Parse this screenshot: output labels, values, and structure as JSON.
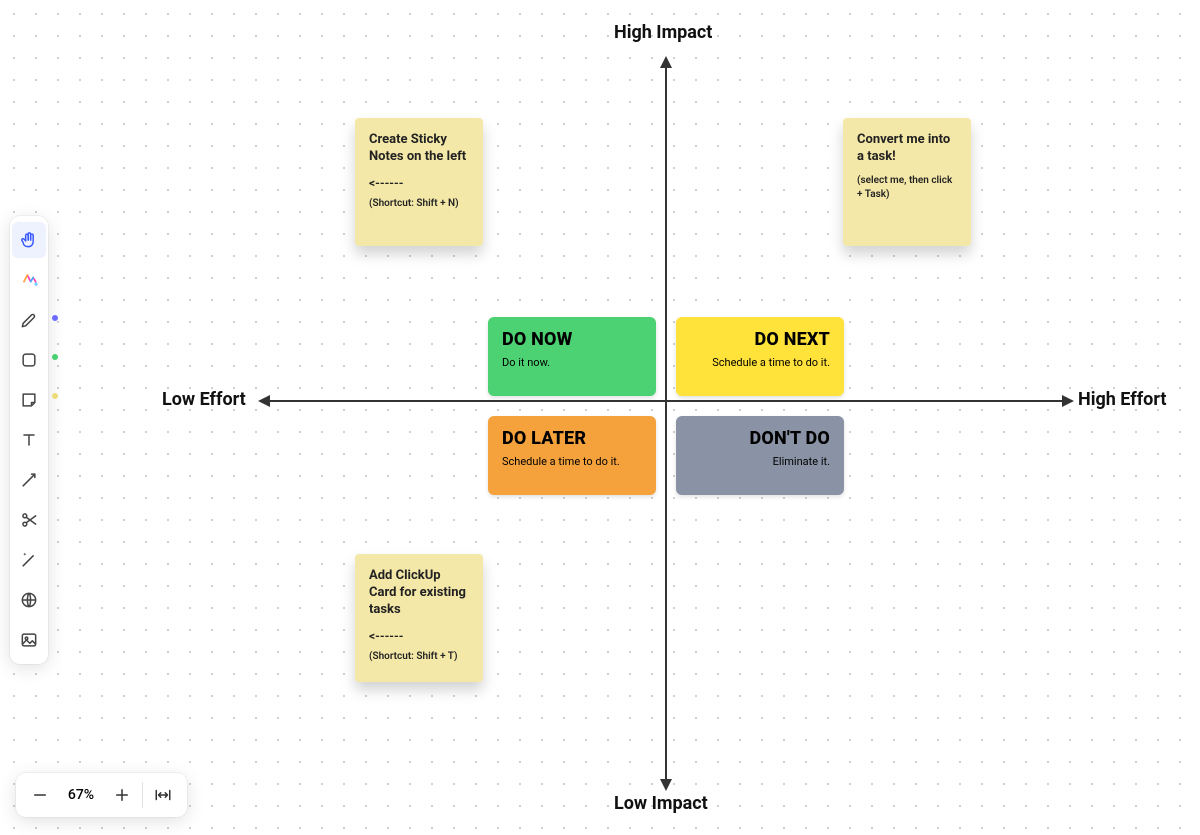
{
  "axes": {
    "top": "High Impact",
    "bottom": "Low Impact",
    "left": "Low Effort",
    "right": "High Effort"
  },
  "quadrants": {
    "do_now": {
      "title": "DO NOW",
      "sub": "Do it now.",
      "color": "#4dd273",
      "text": "#0a3a1a"
    },
    "do_next": {
      "title": "DO NEXT",
      "sub": "Schedule a time to do it.",
      "color": "#ffe23a",
      "text": "#4a3a00"
    },
    "do_later": {
      "title": "DO LATER",
      "sub": "Schedule a time to do it.",
      "color": "#f5a23c",
      "text": "#3a2300"
    },
    "dont_do": {
      "title": "DON'T DO",
      "sub": "Eliminate it.",
      "color": "#8a93a6",
      "text": "#1e232e"
    }
  },
  "stickies": {
    "s1": {
      "title": "Create Sticky Notes on the left",
      "arrow": "<------",
      "sub": "(Shortcut: Shift + N)"
    },
    "s2": {
      "title": "Convert me into a task!",
      "sub": "(select me, then click + Task)"
    },
    "s3": {
      "title": "Add ClickUp Card for existing tasks",
      "arrow": "<------",
      "sub": "(Shortcut: Shift + T)"
    }
  },
  "toolbar": {
    "items": [
      {
        "name": "hand-tool",
        "active": true
      },
      {
        "name": "ai-tool",
        "active": false
      },
      {
        "name": "pen-tool",
        "active": false
      },
      {
        "name": "shape-tool",
        "active": false
      },
      {
        "name": "note-tool",
        "active": false
      },
      {
        "name": "text-tool",
        "active": false
      },
      {
        "name": "connector-tool",
        "active": false
      },
      {
        "name": "scissors-tool",
        "active": false
      },
      {
        "name": "sparkle-tool",
        "active": false
      },
      {
        "name": "web-tool",
        "active": false
      },
      {
        "name": "image-tool",
        "active": false
      }
    ],
    "indicator_colors": {
      "pen": "#6b6bff",
      "shape": "#48d171",
      "note": "#f4e8a8"
    }
  },
  "zoom": {
    "level": "67%"
  }
}
